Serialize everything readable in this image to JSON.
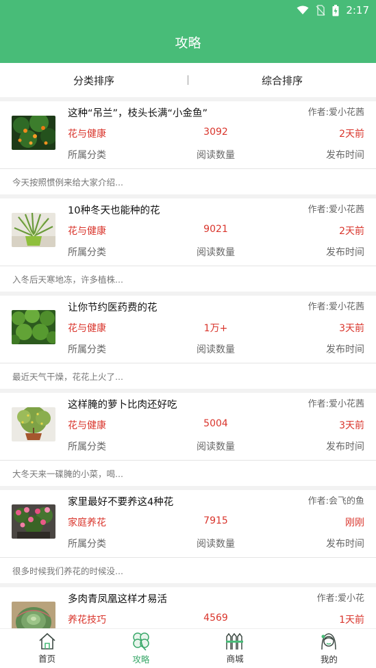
{
  "status": {
    "time": "2:17"
  },
  "title": "攻略",
  "sort": {
    "category": "分类排序",
    "overall": "综合排序"
  },
  "labels": {
    "category": "所属分类",
    "reads": "阅读数量",
    "time": "发布时间"
  },
  "articles": [
    {
      "title": "这种“吊兰”，枝头长满“小金鱼”",
      "author": "作者:爱小花茜",
      "category": "花与健康",
      "reads": "3092",
      "time": "2天前",
      "summary": "今天按照惯例来给大家介绍..."
    },
    {
      "title": "10种冬天也能种的花",
      "author": "作者:爱小花茜",
      "category": "花与健康",
      "reads": "9021",
      "time": "2天前",
      "summary": "入冬后天寒地冻，许多植株..."
    },
    {
      "title": "让你节约医药费的花",
      "author": "作者:爱小花茜",
      "category": "花与健康",
      "reads": "1万+",
      "time": "3天前",
      "summary": "最近天气干燥，花花上火了..."
    },
    {
      "title": "这样腌的萝卜比肉还好吃",
      "author": "作者:爱小花茜",
      "category": "花与健康",
      "reads": "5004",
      "time": "3天前",
      "summary": "大冬天来一碟腌的小菜，喝..."
    },
    {
      "title": "家里最好不要养这4种花",
      "author": "作者:会飞的鱼",
      "category": "家庭养花",
      "reads": "7915",
      "time": "刚刚",
      "summary": "很多时候我们养花的时候没..."
    },
    {
      "title": "多肉青凤凰这样才易活",
      "author": "作者:爱小花",
      "category": "养花技巧",
      "reads": "4569",
      "time": "1天前",
      "summary": ""
    }
  ],
  "tabs": [
    {
      "label": "首页",
      "icon": "house-icon"
    },
    {
      "label": "攻略",
      "icon": "clover-icon",
      "active": true
    },
    {
      "label": "商城",
      "icon": "fence-icon"
    },
    {
      "label": "我的",
      "icon": "girl-avatar-icon"
    }
  ],
  "colors": {
    "brand": "#48bc78",
    "accent": "#d9342b"
  }
}
